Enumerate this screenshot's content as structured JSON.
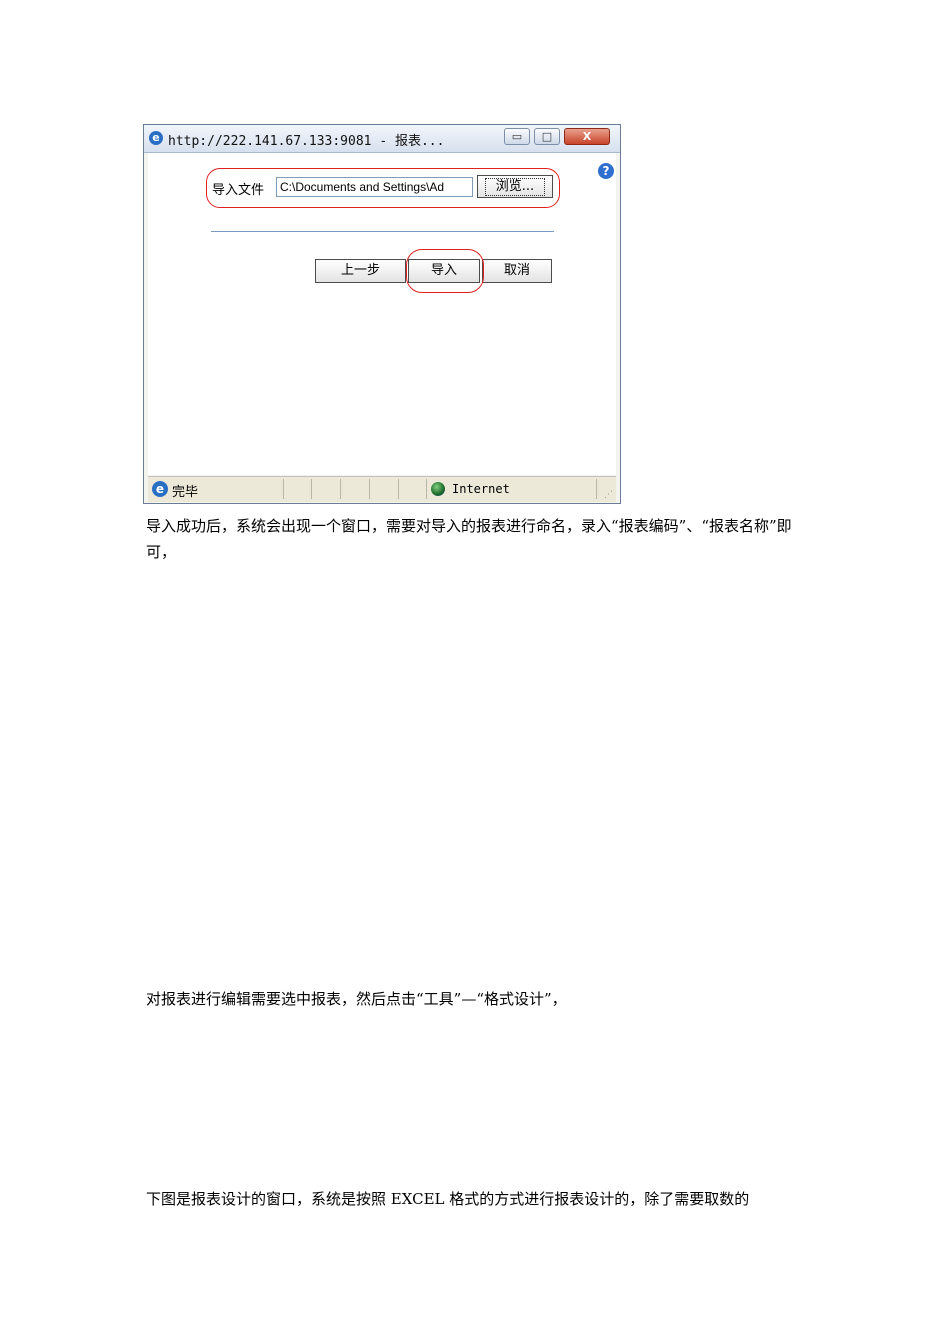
{
  "window": {
    "title": "http://222.141.67.133:9081 - 报表...",
    "minimize": "▭",
    "maximize": "□",
    "close": "X",
    "help": "?"
  },
  "form": {
    "file_label": "导入文件",
    "file_value": "C:\\Documents and Settings\\Ad",
    "browse_label": "浏览...",
    "prev_label": "上一步",
    "import_label": "导入",
    "cancel_label": "取消"
  },
  "statusbar": {
    "status": "完毕",
    "zone": "Internet"
  },
  "paragraphs": {
    "p1": "导入成功后，系统会出现一个窗口，需要对导入的报表进行命名，录入“报表编码”、“报表名称”即可，",
    "p2": "对报表进行编辑需要选中报表，然后点击“工具”—“格式设计”，",
    "p3": "下图是报表设计的窗口，系统是按照 EXCEL 格式的方式进行报表设计的，除了需要取数的"
  }
}
